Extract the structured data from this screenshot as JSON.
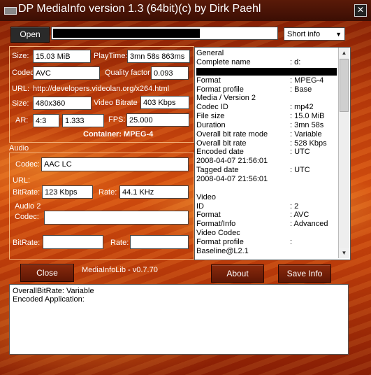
{
  "window": {
    "title": "DP MediaInfo version 1.3 (64bit)(c) by Dirk Paehl",
    "close_glyph": "✕"
  },
  "toolbar": {
    "open_label": "Open",
    "view_select": "Short info",
    "select_arrow": "▼"
  },
  "video": {
    "size_label": "Size:",
    "size_value": "15.03 MiB",
    "playtime_label": "PlayTime:",
    "playtime_value": "3mn 58s 863ms",
    "codec_label": "Codec",
    "codec_value": "AVC",
    "quality_label": "Quality factor",
    "quality_value": "0.093",
    "url_label": "URL:",
    "url_value": "http://developers.videolan.org/x264.html",
    "dim_label": "Size:",
    "dim_value": "480x360",
    "bitrate_label": "Video Bitrate",
    "bitrate_value": "403 Kbps",
    "ar_label": "AR:",
    "ar_value1": "4:3",
    "ar_value2": "1.333",
    "fps_label": "FPS:",
    "fps_value": "25.000",
    "container_label": "Container: MPEG-4"
  },
  "audio": {
    "section_label": "Audio",
    "codec_label": "Codec:",
    "codec_value": "AAC LC",
    "url_label": "URL:",
    "bitrate_label": "BitRate:",
    "bitrate_value": "123 Kbps",
    "rate_label": "Rate:",
    "rate_value": "44.1 KHz",
    "audio2_label": "Audio 2",
    "codec2_label": "Codec:",
    "bitrate2_label": "BitRate:",
    "rate2_label": "Rate:"
  },
  "report": {
    "lines": [
      {
        "k": "General",
        "v": ""
      },
      {
        "k": "Complete name",
        "v": ": d:"
      },
      {
        "k": "__redacted__",
        "v": ""
      },
      {
        "k": "Format",
        "v": ": MPEG-4"
      },
      {
        "k": "Format profile",
        "v": ": Base"
      },
      {
        "k": "Media / Version 2",
        "v": ""
      },
      {
        "k": "Codec ID",
        "v": ": mp42"
      },
      {
        "k": "File size",
        "v": ": 15.0 MiB"
      },
      {
        "k": "Duration",
        "v": ": 3mn 58s"
      },
      {
        "k": "Overall bit rate mode",
        "v": ": Variable"
      },
      {
        "k": "Overall bit rate",
        "v": ": 528 Kbps"
      },
      {
        "k": "Encoded date",
        "v": ": UTC"
      },
      {
        "k": "2008-04-07 21:56:01",
        "v": ""
      },
      {
        "k": "Tagged date",
        "v": ": UTC"
      },
      {
        "k": "2008-04-07 21:56:01",
        "v": ""
      },
      {
        "k": "",
        "v": ""
      },
      {
        "k": "Video",
        "v": ""
      },
      {
        "k": "ID",
        "v": ": 2"
      },
      {
        "k": "Format",
        "v": ": AVC"
      },
      {
        "k": "Format/Info",
        "v": ": Advanced"
      },
      {
        "k": "Video Codec",
        "v": ""
      },
      {
        "k": "Format profile",
        "v": ":"
      },
      {
        "k": "Baseline@L2.1",
        "v": ""
      }
    ]
  },
  "footer": {
    "close_label": "Close",
    "lib_label": "MediaInfoLib - v0.7.70",
    "about_label": "About",
    "save_label": "Save Info"
  },
  "bottom": {
    "line1": "OverallBitRate: Variable",
    "line2": "Encoded Application:"
  },
  "icons": {
    "scroll_up": "▲",
    "scroll_down": "▼"
  }
}
